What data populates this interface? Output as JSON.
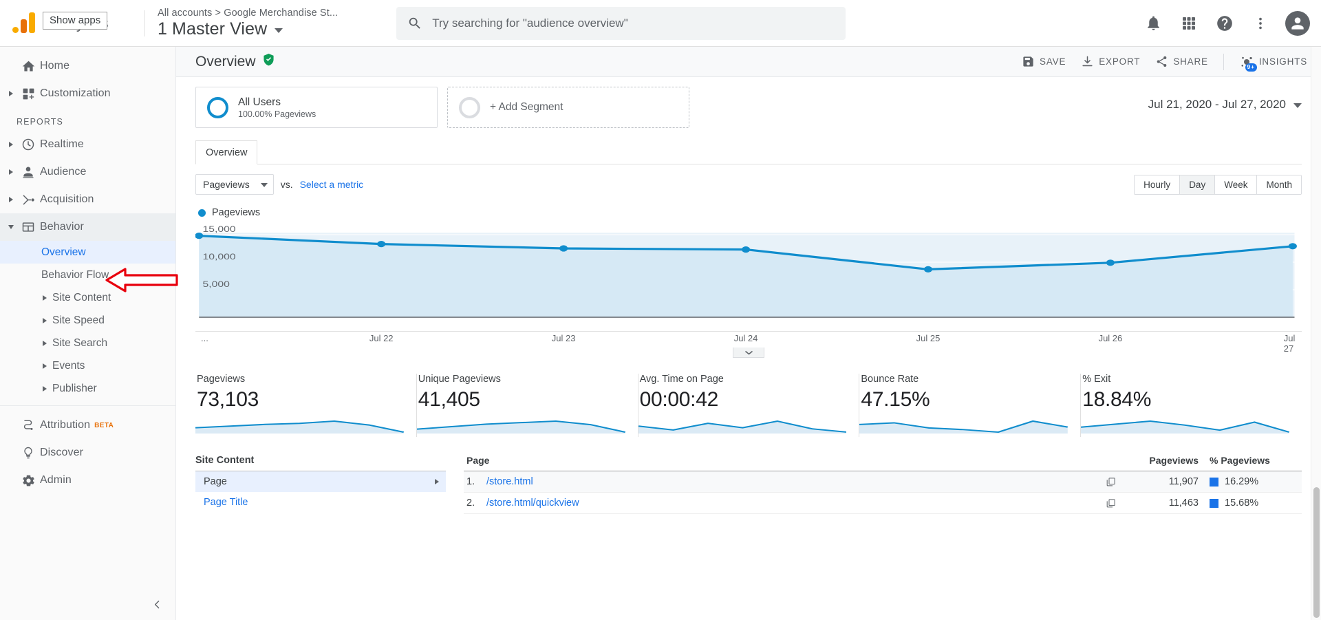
{
  "topbar": {
    "brand_name": "Analytics",
    "tooltip": "Show apps",
    "breadcrumb": "All accounts > Google Merchandise St...",
    "view_name": "1 Master View",
    "search_placeholder": "Try searching for \"audience overview\"",
    "icons": {
      "notifications": "bell-icon",
      "apps": "apps-grid-icon",
      "help": "help-icon",
      "more": "more-vertical-icon",
      "account": "user-avatar-icon"
    }
  },
  "sidebar": {
    "items": [
      {
        "label": "Home",
        "icon": "home-icon",
        "expandable": false
      },
      {
        "label": "Customization",
        "icon": "customization-icon",
        "expandable": true
      }
    ],
    "section_label": "REPORTS",
    "reports": [
      {
        "label": "Realtime",
        "icon": "realtime-clock-icon",
        "expandable": true,
        "expanded": false
      },
      {
        "label": "Audience",
        "icon": "audience-person-icon",
        "expandable": true,
        "expanded": false
      },
      {
        "label": "Acquisition",
        "icon": "acquisition-share-icon",
        "expandable": true,
        "expanded": false
      },
      {
        "label": "Behavior",
        "icon": "behavior-window-icon",
        "expandable": true,
        "expanded": true
      }
    ],
    "behavior_children": [
      {
        "label": "Overview",
        "selected": true,
        "expandable": false
      },
      {
        "label": "Behavior Flow",
        "selected": false,
        "expandable": false
      },
      {
        "label": "Site Content",
        "selected": false,
        "expandable": true
      },
      {
        "label": "Site Speed",
        "selected": false,
        "expandable": true
      },
      {
        "label": "Site Search",
        "selected": false,
        "expandable": true
      },
      {
        "label": "Events",
        "selected": false,
        "expandable": true
      },
      {
        "label": "Publisher",
        "selected": false,
        "expandable": true
      }
    ],
    "footer": [
      {
        "label": "Attribution",
        "icon": "attribution-icon",
        "badge": "BETA"
      },
      {
        "label": "Discover",
        "icon": "discover-bulb-icon",
        "badge": ""
      },
      {
        "label": "Admin",
        "icon": "admin-gear-icon",
        "badge": ""
      }
    ],
    "collapse_icon": "chevron-left-icon",
    "annotation": "red-left-arrow-pointing-at-behavior"
  },
  "page": {
    "title": "Overview",
    "verified_icon": "green-shield-check-icon",
    "actions": [
      {
        "label": "SAVE",
        "icon": "save-disk-icon"
      },
      {
        "label": "EXPORT",
        "icon": "export-download-icon"
      },
      {
        "label": "SHARE",
        "icon": "share-nodes-icon"
      },
      {
        "label": "INSIGHTS",
        "icon": "insights-icon",
        "badge": "9+"
      }
    ]
  },
  "segments": {
    "applied": {
      "name": "All Users",
      "sub": "100.00% Pageviews",
      "ring_color": "#108dcd"
    },
    "add_label": "+ Add Segment",
    "date_range": "Jul 21, 2020 - Jul 27, 2020"
  },
  "tabs": [
    {
      "label": "Overview",
      "active": true
    }
  ],
  "metric_selector": {
    "primary": "Pageviews",
    "vs_label": "vs.",
    "secondary_link": "Select a metric"
  },
  "granularity": {
    "options": [
      "Hourly",
      "Day",
      "Week",
      "Month"
    ],
    "active": "Day"
  },
  "chart_data": {
    "type": "line",
    "title": "Pageviews",
    "legend": [
      "Pageviews"
    ],
    "legend_position": "top-left",
    "series": [
      {
        "name": "Pageviews",
        "color": "#108dcd",
        "values": [
          14800,
          13300,
          12500,
          12300,
          8700,
          9900,
          12900
        ]
      }
    ],
    "x": [
      "...",
      "Jul 22",
      "Jul 23",
      "Jul 24",
      "Jul 25",
      "Jul 26",
      "Jul 27"
    ],
    "xlabel": "",
    "ylabel": "",
    "ylim": [
      0,
      16500
    ],
    "yticks": [
      5000,
      10000,
      15000
    ],
    "ytick_labels": [
      "5,000",
      "10,000",
      "15,000"
    ],
    "grid": true,
    "area_fill": "#e8f2f9"
  },
  "summary_metrics": [
    {
      "label": "Pageviews",
      "value": "73,103",
      "spark": [
        46,
        52,
        58,
        62,
        70,
        56,
        30
      ]
    },
    {
      "label": "Unique Pageviews",
      "value": "41,405",
      "spark": [
        40,
        50,
        60,
        66,
        72,
        58,
        28
      ]
    },
    {
      "label": "Avg. Time on Page",
      "value": "00:00:42",
      "spark": [
        55,
        48,
        60,
        52,
        64,
        50,
        44
      ]
    },
    {
      "label": "Bounce Rate",
      "value": "47.15%",
      "spark": [
        58,
        62,
        50,
        46,
        40,
        66,
        52
      ]
    },
    {
      "label": "% Exit",
      "value": "18.84%",
      "spark": [
        50,
        56,
        62,
        54,
        44,
        60,
        40
      ]
    }
  ],
  "site_content": {
    "title": "Site Content",
    "rows": [
      {
        "label": "Page",
        "selected": true,
        "has_arrow": true,
        "link": false
      },
      {
        "label": "Page Title",
        "selected": false,
        "has_arrow": false,
        "link": true
      }
    ]
  },
  "page_table": {
    "columns": {
      "page": "Page",
      "pageviews": "Pageviews",
      "pct_pageviews": "% Pageviews"
    },
    "rows": [
      {
        "index": "1.",
        "page": "/store.html",
        "pageviews": "11,907",
        "pct": "16.29%",
        "icon": "open-report-icon"
      },
      {
        "index": "2.",
        "page": "/store.html/quickview",
        "pageviews": "11,463",
        "pct": "15.68%",
        "icon": "open-report-icon"
      }
    ],
    "swatch_color": "#1a73e8"
  }
}
